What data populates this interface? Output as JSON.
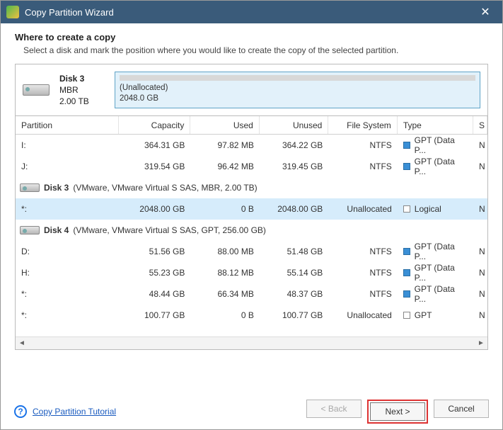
{
  "title": "Copy Partition Wizard",
  "header": {
    "heading": "Where to create a copy",
    "sub": "Select a disk and mark the position where you would like to create the copy of the selected partition."
  },
  "target_disk": {
    "name": "Disk 3",
    "scheme": "MBR",
    "size": "2.00 TB",
    "alloc_label": "(Unallocated)",
    "alloc_size": "2048.0 GB"
  },
  "columns": [
    "Partition",
    "Capacity",
    "Used",
    "Unused",
    "File System",
    "Type",
    "S"
  ],
  "rows_top": [
    {
      "p": "I:",
      "cap": "364.31 GB",
      "used": "97.82 MB",
      "un": "364.22 GB",
      "fs": "NTFS",
      "sq": "blue",
      "type": "GPT (Data P...",
      "s": "N"
    },
    {
      "p": "J:",
      "cap": "319.54 GB",
      "used": "96.42 MB",
      "un": "319.45 GB",
      "fs": "NTFS",
      "sq": "blue",
      "type": "GPT (Data P...",
      "s": "N"
    }
  ],
  "group3": "Disk 3 (VMware, VMware Virtual S SAS, MBR, 2.00 TB)",
  "row3": {
    "p": "*:",
    "cap": "2048.00 GB",
    "used": "0 B",
    "un": "2048.00 GB",
    "fs": "Unallocated",
    "sq": "gray",
    "type": "Logical",
    "s": "N"
  },
  "group4": "Disk 4 (VMware, VMware Virtual S SAS, GPT, 256.00 GB)",
  "rows4": [
    {
      "p": "D:",
      "cap": "51.56 GB",
      "used": "88.00 MB",
      "un": "51.48 GB",
      "fs": "NTFS",
      "sq": "blue",
      "type": "GPT (Data P...",
      "s": "N"
    },
    {
      "p": "H:",
      "cap": "55.23 GB",
      "used": "88.12 MB",
      "un": "55.14 GB",
      "fs": "NTFS",
      "sq": "blue",
      "type": "GPT (Data P...",
      "s": "N"
    },
    {
      "p": "*:",
      "cap": "48.44 GB",
      "used": "66.34 MB",
      "un": "48.37 GB",
      "fs": "NTFS",
      "sq": "blue",
      "type": "GPT (Data P...",
      "s": "N"
    },
    {
      "p": "*:",
      "cap": "100.77 GB",
      "used": "0 B",
      "un": "100.77 GB",
      "fs": "Unallocated",
      "sq": "gray",
      "type": "GPT",
      "s": "N"
    }
  ],
  "help_link": "Copy Partition Tutorial",
  "buttons": {
    "back": "< Back",
    "next": "Next >",
    "cancel": "Cancel"
  }
}
